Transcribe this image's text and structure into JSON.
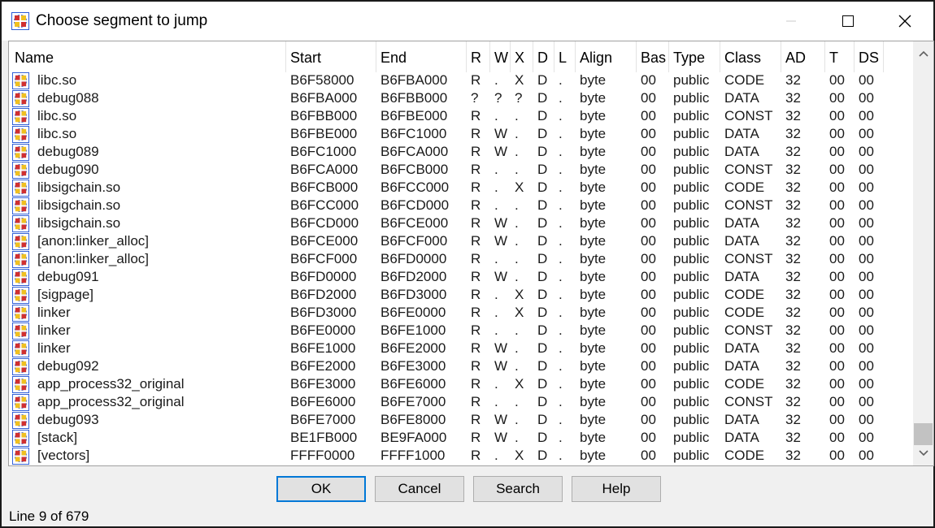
{
  "window": {
    "title": "Choose segment to jump",
    "icon": "ida-segment-icon"
  },
  "columns": [
    "Name",
    "Start",
    "End",
    "R",
    "W",
    "X",
    "D",
    "L",
    "Align",
    "Bas",
    "Type",
    "Class",
    "AD",
    "T",
    "DS"
  ],
  "rows": [
    [
      "libc.so",
      "B6F58000",
      "B6FBA000",
      "R",
      ".",
      "X",
      "D",
      ".",
      "byte",
      "00",
      "public",
      "CODE",
      "32",
      "00",
      "00"
    ],
    [
      "debug088",
      "B6FBA000",
      "B6FBB000",
      "?",
      "?",
      "?",
      "D",
      ".",
      "byte",
      "00",
      "public",
      "DATA",
      "32",
      "00",
      "00"
    ],
    [
      "libc.so",
      "B6FBB000",
      "B6FBE000",
      "R",
      ".",
      ".",
      "D",
      ".",
      "byte",
      "00",
      "public",
      "CONST",
      "32",
      "00",
      "00"
    ],
    [
      "libc.so",
      "B6FBE000",
      "B6FC1000",
      "R",
      "W",
      ".",
      "D",
      ".",
      "byte",
      "00",
      "public",
      "DATA",
      "32",
      "00",
      "00"
    ],
    [
      "debug089",
      "B6FC1000",
      "B6FCA000",
      "R",
      "W",
      ".",
      "D",
      ".",
      "byte",
      "00",
      "public",
      "DATA",
      "32",
      "00",
      "00"
    ],
    [
      "debug090",
      "B6FCA000",
      "B6FCB000",
      "R",
      ".",
      ".",
      "D",
      ".",
      "byte",
      "00",
      "public",
      "CONST",
      "32",
      "00",
      "00"
    ],
    [
      "libsigchain.so",
      "B6FCB000",
      "B6FCC000",
      "R",
      ".",
      "X",
      "D",
      ".",
      "byte",
      "00",
      "public",
      "CODE",
      "32",
      "00",
      "00"
    ],
    [
      "libsigchain.so",
      "B6FCC000",
      "B6FCD000",
      "R",
      ".",
      ".",
      "D",
      ".",
      "byte",
      "00",
      "public",
      "CONST",
      "32",
      "00",
      "00"
    ],
    [
      "libsigchain.so",
      "B6FCD000",
      "B6FCE000",
      "R",
      "W",
      ".",
      "D",
      ".",
      "byte",
      "00",
      "public",
      "DATA",
      "32",
      "00",
      "00"
    ],
    [
      "[anon:linker_alloc]",
      "B6FCE000",
      "B6FCF000",
      "R",
      "W",
      ".",
      "D",
      ".",
      "byte",
      "00",
      "public",
      "DATA",
      "32",
      "00",
      "00"
    ],
    [
      "[anon:linker_alloc]",
      "B6FCF000",
      "B6FD0000",
      "R",
      ".",
      ".",
      "D",
      ".",
      "byte",
      "00",
      "public",
      "CONST",
      "32",
      "00",
      "00"
    ],
    [
      "debug091",
      "B6FD0000",
      "B6FD2000",
      "R",
      "W",
      ".",
      "D",
      ".",
      "byte",
      "00",
      "public",
      "DATA",
      "32",
      "00",
      "00"
    ],
    [
      "[sigpage]",
      "B6FD2000",
      "B6FD3000",
      "R",
      ".",
      "X",
      "D",
      ".",
      "byte",
      "00",
      "public",
      "CODE",
      "32",
      "00",
      "00"
    ],
    [
      "linker",
      "B6FD3000",
      "B6FE0000",
      "R",
      ".",
      "X",
      "D",
      ".",
      "byte",
      "00",
      "public",
      "CODE",
      "32",
      "00",
      "00"
    ],
    [
      "linker",
      "B6FE0000",
      "B6FE1000",
      "R",
      ".",
      ".",
      "D",
      ".",
      "byte",
      "00",
      "public",
      "CONST",
      "32",
      "00",
      "00"
    ],
    [
      "linker",
      "B6FE1000",
      "B6FE2000",
      "R",
      "W",
      ".",
      "D",
      ".",
      "byte",
      "00",
      "public",
      "DATA",
      "32",
      "00",
      "00"
    ],
    [
      "debug092",
      "B6FE2000",
      "B6FE3000",
      "R",
      "W",
      ".",
      "D",
      ".",
      "byte",
      "00",
      "public",
      "DATA",
      "32",
      "00",
      "00"
    ],
    [
      "app_process32_original",
      "B6FE3000",
      "B6FE6000",
      "R",
      ".",
      "X",
      "D",
      ".",
      "byte",
      "00",
      "public",
      "CODE",
      "32",
      "00",
      "00"
    ],
    [
      "app_process32_original",
      "B6FE6000",
      "B6FE7000",
      "R",
      ".",
      ".",
      "D",
      ".",
      "byte",
      "00",
      "public",
      "CONST",
      "32",
      "00",
      "00"
    ],
    [
      "debug093",
      "B6FE7000",
      "B6FE8000",
      "R",
      "W",
      ".",
      "D",
      ".",
      "byte",
      "00",
      "public",
      "DATA",
      "32",
      "00",
      "00"
    ],
    [
      "[stack]",
      "BE1FB000",
      "BE9FA000",
      "R",
      "W",
      ".",
      "D",
      ".",
      "byte",
      "00",
      "public",
      "DATA",
      "32",
      "00",
      "00"
    ],
    [
      "[vectors]",
      "FFFF0000",
      "FFFF1000",
      "R",
      ".",
      "X",
      "D",
      ".",
      "byte",
      "00",
      "public",
      "CODE",
      "32",
      "00",
      "00"
    ]
  ],
  "buttons": {
    "ok": "OK",
    "cancel": "Cancel",
    "search": "Search",
    "help": "Help"
  },
  "status": "Line 9 of 679",
  "colors": {
    "default_button_border": "#0078d7",
    "icon_red": "#d03030",
    "icon_blue": "#2a5bd7",
    "icon_yellow": "#f0c020"
  }
}
